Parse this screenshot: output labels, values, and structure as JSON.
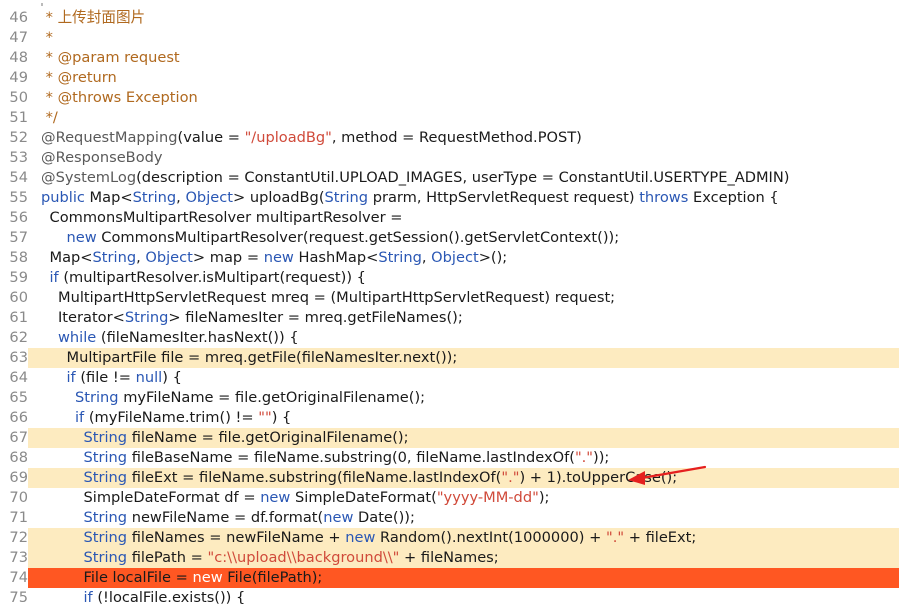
{
  "editor": {
    "lines": [
      {
        "num": "46",
        "indent": 0,
        "highlight": "none",
        "tokens": [
          {
            "t": " * 上传封面图片",
            "c": "comment"
          }
        ]
      },
      {
        "num": "47",
        "indent": 0,
        "highlight": "none",
        "tokens": [
          {
            "t": " *",
            "c": "comment"
          }
        ]
      },
      {
        "num": "48",
        "indent": 0,
        "highlight": "none",
        "tokens": [
          {
            "t": " * @param request",
            "c": "comment"
          }
        ]
      },
      {
        "num": "49",
        "indent": 0,
        "highlight": "none",
        "tokens": [
          {
            "t": " * @return",
            "c": "comment"
          }
        ]
      },
      {
        "num": "50",
        "indent": 0,
        "highlight": "none",
        "tokens": [
          {
            "t": " * @throws Exception",
            "c": "comment"
          }
        ]
      },
      {
        "num": "51",
        "indent": 0,
        "highlight": "none",
        "tokens": [
          {
            "t": " */",
            "c": "comment"
          }
        ]
      },
      {
        "num": "52",
        "indent": 0,
        "highlight": "none",
        "tokens": [
          {
            "t": "@RequestMapping",
            "c": "ann"
          },
          {
            "t": "(value = ",
            "c": "plain"
          },
          {
            "t": "\"/uploadBg\"",
            "c": "str"
          },
          {
            "t": ", method = RequestMethod.POST)",
            "c": "plain"
          }
        ]
      },
      {
        "num": "53",
        "indent": 0,
        "highlight": "none",
        "tokens": [
          {
            "t": "@ResponseBody",
            "c": "ann"
          }
        ]
      },
      {
        "num": "54",
        "indent": 0,
        "highlight": "none",
        "tokens": [
          {
            "t": "@SystemLog",
            "c": "ann"
          },
          {
            "t": "(description = ConstantUtil.UPLOAD_IMAGES, userType = ConstantUtil.USERTYPE_ADMIN)",
            "c": "plain"
          }
        ]
      },
      {
        "num": "55",
        "indent": 0,
        "highlight": "none",
        "tokens": [
          {
            "t": "public",
            "c": "kw"
          },
          {
            "t": " Map<",
            "c": "plain"
          },
          {
            "t": "String",
            "c": "type"
          },
          {
            "t": ", ",
            "c": "plain"
          },
          {
            "t": "Object",
            "c": "type"
          },
          {
            "t": "> uploadBg(",
            "c": "plain"
          },
          {
            "t": "String",
            "c": "type"
          },
          {
            "t": " prarm, HttpServletRequest request) ",
            "c": "plain"
          },
          {
            "t": "throws",
            "c": "kw"
          },
          {
            "t": " Exception {",
            "c": "plain"
          }
        ]
      },
      {
        "num": "56",
        "indent": 1,
        "highlight": "none",
        "tokens": [
          {
            "t": "CommonsMultipartResolver multipartResolver =",
            "c": "plain"
          }
        ]
      },
      {
        "num": "57",
        "indent": 3,
        "highlight": "none",
        "tokens": [
          {
            "t": "new",
            "c": "kw"
          },
          {
            "t": " CommonsMultipartResolver(request.getSession().getServletContext());",
            "c": "plain"
          }
        ]
      },
      {
        "num": "58",
        "indent": 1,
        "highlight": "none",
        "tokens": [
          {
            "t": "Map<",
            "c": "plain"
          },
          {
            "t": "String",
            "c": "type"
          },
          {
            "t": ", ",
            "c": "plain"
          },
          {
            "t": "Object",
            "c": "type"
          },
          {
            "t": "> map = ",
            "c": "plain"
          },
          {
            "t": "new",
            "c": "kw"
          },
          {
            "t": " HashMap<",
            "c": "plain"
          },
          {
            "t": "String",
            "c": "type"
          },
          {
            "t": ", ",
            "c": "plain"
          },
          {
            "t": "Object",
            "c": "type"
          },
          {
            "t": ">();",
            "c": "plain"
          }
        ]
      },
      {
        "num": "59",
        "indent": 1,
        "highlight": "none",
        "tokens": [
          {
            "t": "if",
            "c": "kw"
          },
          {
            "t": " (multipartResolver.isMultipart(request)) {",
            "c": "plain"
          }
        ]
      },
      {
        "num": "60",
        "indent": 2,
        "highlight": "none",
        "tokens": [
          {
            "t": "MultipartHttpServletRequest mreq = (MultipartHttpServletRequest) request;",
            "c": "plain"
          }
        ]
      },
      {
        "num": "61",
        "indent": 2,
        "highlight": "none",
        "tokens": [
          {
            "t": "Iterator<",
            "c": "plain"
          },
          {
            "t": "String",
            "c": "type"
          },
          {
            "t": "> fileNamesIter = mreq.getFileNames();",
            "c": "plain"
          }
        ]
      },
      {
        "num": "62",
        "indent": 2,
        "highlight": "none",
        "tokens": [
          {
            "t": "while",
            "c": "kw"
          },
          {
            "t": " (fileNamesIter.hasNext()) {",
            "c": "plain"
          }
        ]
      },
      {
        "num": "63",
        "indent": 3,
        "highlight": "yellow",
        "tokens": [
          {
            "t": "MultipartFile file = mreq.getFile(fileNamesIter.next());",
            "c": "plain"
          }
        ]
      },
      {
        "num": "64",
        "indent": 3,
        "highlight": "none",
        "tokens": [
          {
            "t": "if",
            "c": "kw"
          },
          {
            "t": " (file != ",
            "c": "plain"
          },
          {
            "t": "null",
            "c": "kw"
          },
          {
            "t": ") {",
            "c": "plain"
          }
        ]
      },
      {
        "num": "65",
        "indent": 4,
        "highlight": "none",
        "tokens": [
          {
            "t": "String",
            "c": "type"
          },
          {
            "t": " myFileName = file.getOriginalFilename();",
            "c": "plain"
          }
        ]
      },
      {
        "num": "66",
        "indent": 4,
        "highlight": "none",
        "tokens": [
          {
            "t": "if",
            "c": "kw"
          },
          {
            "t": " (myFileName.trim() != ",
            "c": "plain"
          },
          {
            "t": "\"\"",
            "c": "str"
          },
          {
            "t": ") {",
            "c": "plain"
          }
        ]
      },
      {
        "num": "67",
        "indent": 5,
        "highlight": "yellow",
        "tokens": [
          {
            "t": "String",
            "c": "type"
          },
          {
            "t": " fileName = file.getOriginalFilename();",
            "c": "plain"
          }
        ]
      },
      {
        "num": "68",
        "indent": 5,
        "highlight": "none",
        "tokens": [
          {
            "t": "String",
            "c": "type"
          },
          {
            "t": " fileBaseName = fileName.substring(0, fileName.lastIndexOf(",
            "c": "plain"
          },
          {
            "t": "\".\"",
            "c": "str"
          },
          {
            "t": "));",
            "c": "plain"
          }
        ]
      },
      {
        "num": "69",
        "indent": 5,
        "highlight": "yellow",
        "tokens": [
          {
            "t": "String",
            "c": "type"
          },
          {
            "t": " fileExt = fileName.substring(fileName.lastIndexOf(",
            "c": "plain"
          },
          {
            "t": "\".\"",
            "c": "str"
          },
          {
            "t": ") + 1).toUpperCase();",
            "c": "plain"
          }
        ]
      },
      {
        "num": "70",
        "indent": 5,
        "highlight": "none",
        "tokens": [
          {
            "t": "SimpleDateFormat df = ",
            "c": "plain"
          },
          {
            "t": "new",
            "c": "kw"
          },
          {
            "t": " SimpleDateFormat(",
            "c": "plain"
          },
          {
            "t": "\"yyyy-MM-dd\"",
            "c": "str"
          },
          {
            "t": ");",
            "c": "plain"
          }
        ]
      },
      {
        "num": "71",
        "indent": 5,
        "highlight": "none",
        "tokens": [
          {
            "t": "String",
            "c": "type"
          },
          {
            "t": " newFileName = df.format(",
            "c": "plain"
          },
          {
            "t": "new",
            "c": "kw"
          },
          {
            "t": " Date());",
            "c": "plain"
          }
        ]
      },
      {
        "num": "72",
        "indent": 5,
        "highlight": "yellow",
        "tokens": [
          {
            "t": "String",
            "c": "type"
          },
          {
            "t": " fileNames = newFileName + ",
            "c": "plain"
          },
          {
            "t": "new",
            "c": "kw"
          },
          {
            "t": " Random().nextInt(1000000) + ",
            "c": "plain"
          },
          {
            "t": "\".\"",
            "c": "str"
          },
          {
            "t": " + fileExt;",
            "c": "plain"
          }
        ]
      },
      {
        "num": "73",
        "indent": 5,
        "highlight": "yellow",
        "tokens": [
          {
            "t": "String",
            "c": "type"
          },
          {
            "t": " filePath = ",
            "c": "plain"
          },
          {
            "t": "\"c:\\\\upload\\\\background\\\\\"",
            "c": "str"
          },
          {
            "t": " + fileNames;",
            "c": "plain"
          }
        ]
      },
      {
        "num": "74",
        "indent": 5,
        "highlight": "red",
        "tokens": [
          {
            "t": "File localFile = ",
            "c": "plain"
          },
          {
            "t": "new",
            "c": "kw"
          },
          {
            "t": " File(filePath);",
            "c": "plain"
          }
        ]
      },
      {
        "num": "75",
        "indent": 5,
        "highlight": "none",
        "tokens": [
          {
            "t": "if",
            "c": "kw"
          },
          {
            "t": " (!localFile.exists()) {",
            "c": "plain"
          }
        ]
      }
    ],
    "arrow_color": "#e5201f"
  }
}
